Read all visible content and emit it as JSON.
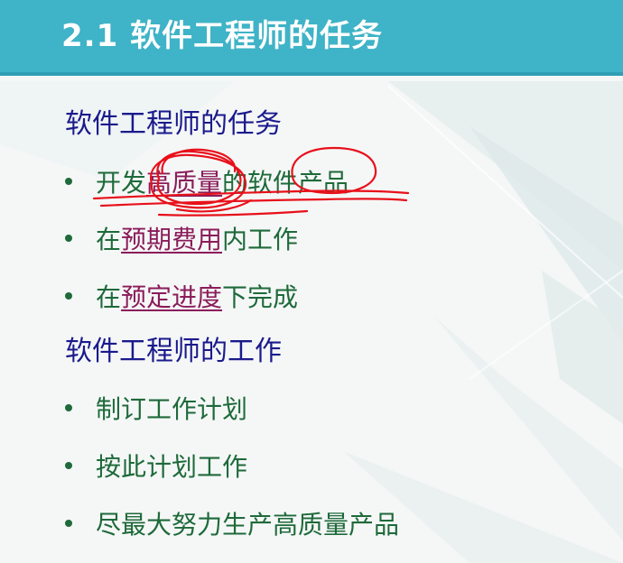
{
  "title": "2.1 软件工程师的任务",
  "sections": [
    {
      "heading": "软件工程师的任务",
      "bullets": [
        {
          "segments": [
            {
              "text": "开发",
              "link": false
            },
            {
              "text": "高质量",
              "link": true
            },
            {
              "text": "的软件产品",
              "link": false
            }
          ]
        },
        {
          "segments": [
            {
              "text": "在",
              "link": false
            },
            {
              "text": "预期费用",
              "link": true
            },
            {
              "text": "内工作",
              "link": false
            }
          ]
        },
        {
          "segments": [
            {
              "text": "在",
              "link": false
            },
            {
              "text": "预定进度",
              "link": true
            },
            {
              "text": "下完成",
              "link": false
            }
          ]
        }
      ]
    },
    {
      "heading": "软件工程师的工作",
      "bullets": [
        {
          "segments": [
            {
              "text": "制订工作计划",
              "link": false
            }
          ]
        },
        {
          "segments": [
            {
              "text": "按此计划工作",
              "link": false
            }
          ]
        },
        {
          "segments": [
            {
              "text": "尽最大努力生产高质量产品",
              "link": false
            }
          ]
        }
      ]
    }
  ],
  "colors": {
    "title_bar": "#3fb3c7",
    "heading": "#1a1a8c",
    "bullet_text": "#1e6a3a",
    "link_text": "#8a1c5a",
    "annotation_ink": "#e8101a"
  }
}
